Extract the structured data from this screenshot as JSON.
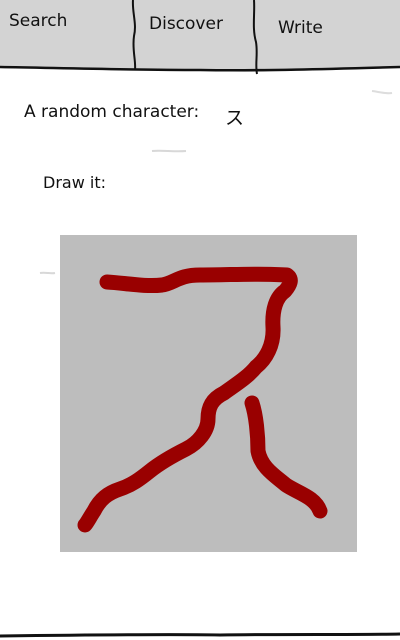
{
  "tabs": [
    {
      "label": "Search",
      "selected": false
    },
    {
      "label": "Discover",
      "selected": false
    },
    {
      "label": "Write",
      "selected": true
    }
  ],
  "prompt": {
    "label": "A random character:",
    "character": "ス"
  },
  "drawing": {
    "label": "Draw it:",
    "stroke_color": "#990000",
    "canvas_color": "#bdbdbd"
  },
  "colors": {
    "tab_background": "#d3d3d3",
    "text": "#111111",
    "page_background": "#ffffff"
  }
}
